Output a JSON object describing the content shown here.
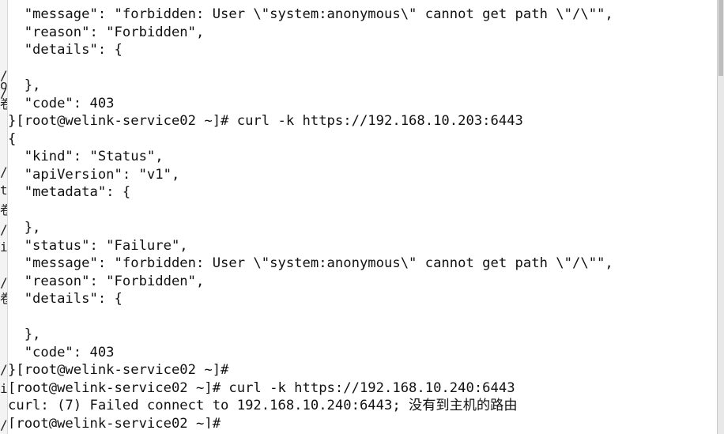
{
  "terminal": {
    "lines": [
      "  \"message\": \"forbidden: User \\\"system:anonymous\\\" cannot get path \\\"/\\\"\",",
      "  \"reason\": \"Forbidden\",",
      "  \"details\": {",
      "",
      "  },",
      "  \"code\": 403",
      "}[root@welink-service02 ~]# curl -k https://192.168.10.203:6443",
      "{",
      "  \"kind\": \"Status\",",
      "  \"apiVersion\": \"v1\",",
      "  \"metadata\": {",
      "",
      "  },",
      "  \"status\": \"Failure\",",
      "  \"message\": \"forbidden: User \\\"system:anonymous\\\" cannot get path \\\"/\\\"\",",
      "  \"reason\": \"Forbidden\",",
      "  \"details\": {",
      "",
      "  },",
      "  \"code\": 403",
      "}[root@welink-service02 ~]#",
      "[root@welink-service02 ~]# curl -k https://192.168.10.240:6443",
      "curl: (7) Failed connect to 192.168.10.240:6443; 没有到主机的路由",
      "[root@welink-service02 ~]#"
    ]
  },
  "left_edge_marks": [
    "/",
    "o",
    "/",
    "卷",
    "/",
    "t",
    "卷",
    "/",
    "i:",
    "/",
    "卷",
    "/",
    "i:",
    "/"
  ],
  "colors": {
    "background": "#ffffff",
    "text": "#111111",
    "edge": "#f3f3f3"
  }
}
